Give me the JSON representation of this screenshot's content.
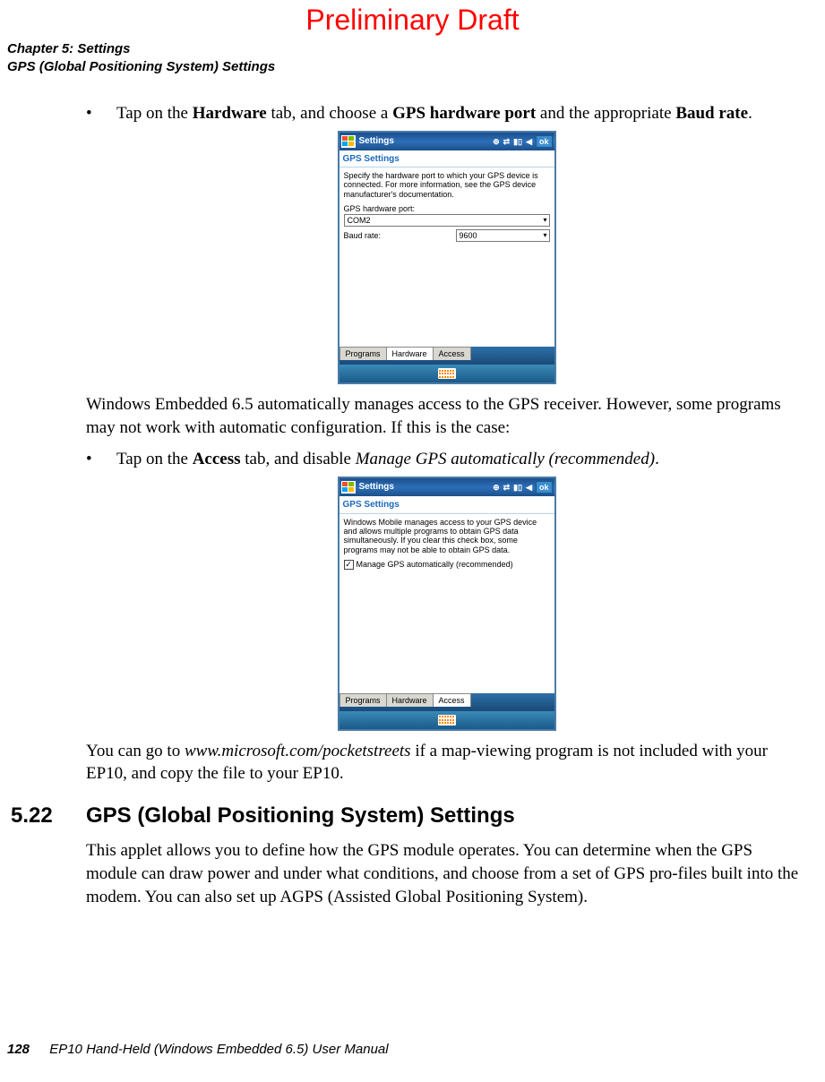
{
  "watermark": "Preliminary Draft",
  "header": {
    "line1": "Chapter 5: Settings",
    "line2": "GPS (Global Positioning System) Settings"
  },
  "bullet1": {
    "pre": "Tap on the ",
    "b1": "Hardware",
    "mid1": " tab, and choose a ",
    "b2": "GPS hardware port",
    "mid2": " and the appropriate ",
    "b3": "Baud rate",
    "post": "."
  },
  "shot1": {
    "title": "Settings",
    "ok": "ok",
    "subtitle": "GPS Settings",
    "desc": "Specify the hardware port to which your GPS device is connected. For more information, see the GPS device manufacturer's documentation.",
    "label_port": "GPS hardware port:",
    "port_value": "COM2",
    "label_baud": "Baud rate:",
    "baud_value": "9600",
    "tabs": [
      "Programs",
      "Hardware",
      "Access"
    ],
    "active_tab": 1
  },
  "para1": "Windows Embedded 6.5 automatically manages access to the GPS receiver. However, some programs may not work with automatic configuration. If this is the case:",
  "bullet2": {
    "pre": "Tap on the ",
    "b1": "Access",
    "mid": " tab, and disable ",
    "i1": "Manage GPS automatically (recommended)",
    "post": "."
  },
  "shot2": {
    "title": "Settings",
    "ok": "ok",
    "subtitle": "GPS Settings",
    "desc": "Windows Mobile manages access to your GPS device and allows multiple programs to obtain GPS data simultaneously. If you clear this check box, some programs may not be able to obtain GPS data.",
    "checkbox_label": "Manage GPS automatically (recommended)",
    "checked": true,
    "tabs": [
      "Programs",
      "Hardware",
      "Access"
    ],
    "active_tab": 2
  },
  "para2": {
    "pre": "You can go to ",
    "i1": "www.microsoft.com/pocketstreets",
    "post": " if a map-viewing program is not included with your EP10, and copy the file to your EP10."
  },
  "section": {
    "num": "5.22",
    "title": "GPS (Global Positioning System) Settings"
  },
  "para3": "This applet allows you to define how the GPS module operates. You can determine when the GPS module can draw power and under what conditions, and choose from a set of GPS pro-files built into the modem. You can also set up AGPS (Assisted Global Positioning System).",
  "footer": {
    "page": "128",
    "doc": "EP10 Hand-Held (Windows Embedded 6.5) User Manual"
  }
}
